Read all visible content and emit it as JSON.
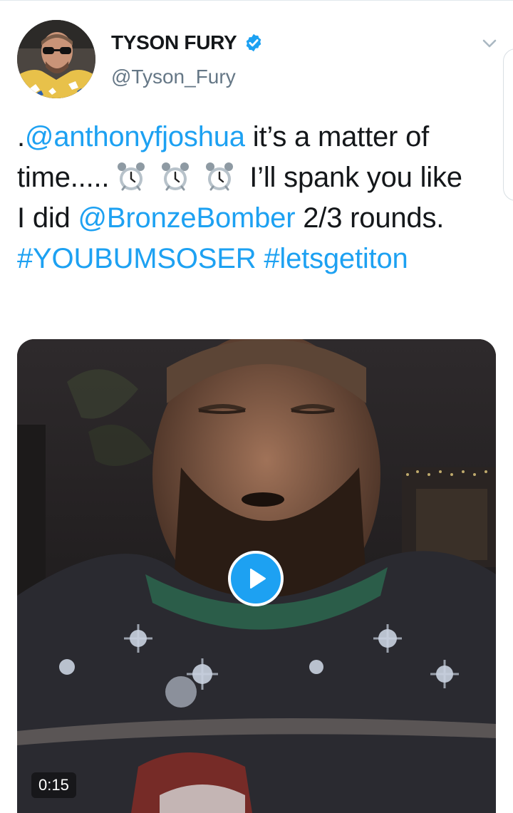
{
  "author": {
    "display_name": "TYSON FURY",
    "handle": "@Tyson_Fury",
    "verified": true
  },
  "tweet": {
    "segments": {
      "s1": ".",
      "s2": "@anthonyfjoshua",
      "s3": " it’s a matter of time.....",
      "s4": " I’ll spank you like I did ",
      "s5": "@BronzeBomber",
      "s6": " 2/3 rounds. ",
      "s7": "#YOUBUMSOSER",
      "s8": "#letsgetiton"
    },
    "emoji": [
      "alarm-clock",
      "alarm-clock",
      "alarm-clock"
    ]
  },
  "media": {
    "type": "video",
    "duration": "0:15"
  },
  "colors": {
    "link": "#1da1f2",
    "text": "#14171a",
    "secondary": "#657786",
    "verified": "#1da1f2"
  },
  "icons": {
    "menu": "chevron-down-icon",
    "verified": "verified-badge-icon",
    "play": "play-icon"
  }
}
